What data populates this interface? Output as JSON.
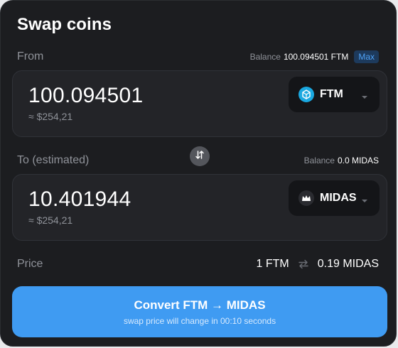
{
  "title": "Swap coins",
  "from": {
    "label": "From",
    "balance_label": "Balance",
    "balance_value": "100.094501 FTM",
    "max_label": "Max",
    "amount": "100.094501",
    "usd": "≈ $254,21",
    "token": "FTM",
    "token_icon": "fantom-icon"
  },
  "to": {
    "label": "To (estimated)",
    "balance_label": "Balance",
    "balance_value": "0.0 MIDAS",
    "amount": "10.401944",
    "usd": "≈ $254,21",
    "token": "MIDAS",
    "token_icon": "midas-icon"
  },
  "price": {
    "label": "Price",
    "left": "1 FTM",
    "right": "0.19 MIDAS"
  },
  "convert": {
    "label": "Convert FTM → MIDAS",
    "sub": "swap price will change in 00:10 seconds"
  },
  "colors": {
    "background": "#1c1d20",
    "field": "#232428",
    "accent": "#3f9bf2",
    "muted": "#8f9299"
  }
}
